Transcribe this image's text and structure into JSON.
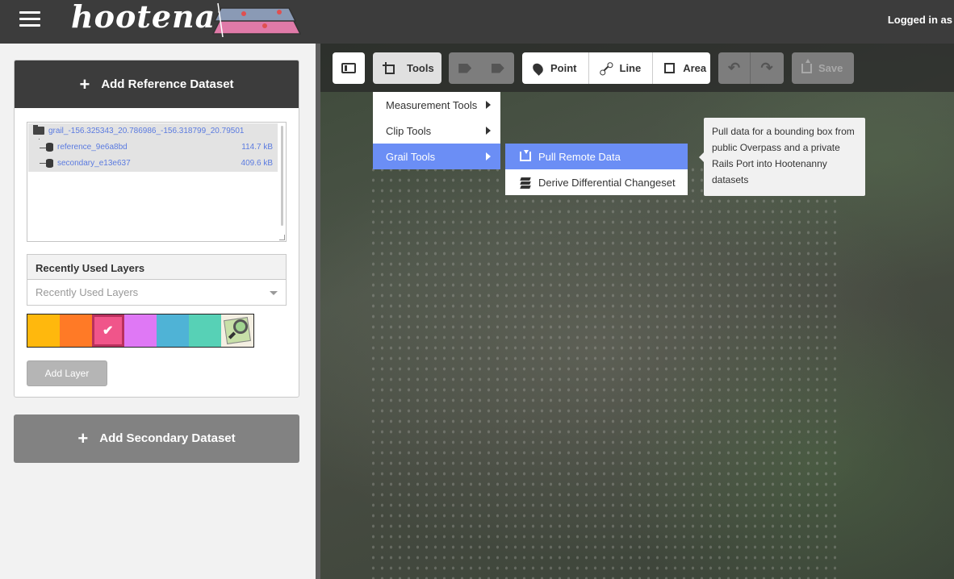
{
  "app": {
    "name": "hootenanny",
    "login_text": "Logged in as"
  },
  "sidebar": {
    "reference_panel": {
      "add_label": "Add Reference Dataset",
      "tree": {
        "folder": "grail_-156.325343_20.786986_-156.318799_20.79501",
        "items": [
          {
            "name": "reference_9e6a8bd",
            "size": "114.7 kB"
          },
          {
            "name": "secondary_e13e637",
            "size": "409.6 kB"
          }
        ]
      },
      "recent_layers": {
        "title": "Recently Used Layers",
        "placeholder": "Recently Used Layers"
      },
      "palette": [
        "#ffb80d",
        "#ff7a26",
        "#f0558a",
        "#df78f5",
        "#4fb3d6",
        "#57d1b6"
      ],
      "selected_swatch": 2,
      "add_layer_label": "Add Layer"
    },
    "secondary_panel": {
      "add_label": "Add Secondary Dataset"
    }
  },
  "toolbar": {
    "tools_label": "Tools",
    "point_label": "Point",
    "line_label": "Line",
    "area_label": "Area",
    "save_label": "Save"
  },
  "tools_menu": {
    "items": [
      {
        "label": "Measurement Tools"
      },
      {
        "label": "Clip Tools"
      },
      {
        "label": "Grail Tools"
      }
    ],
    "active_index": 2
  },
  "grail_menu": {
    "items": [
      {
        "label": "Pull Remote Data"
      },
      {
        "label": "Derive Differential Changeset"
      }
    ]
  },
  "tooltip": {
    "text": "Pull data for a bounding box from public Overpass and a private Rails Port into Hootenanny datasets"
  },
  "colors": {
    "accent": "#6b8ef5",
    "header_bg": "#3c3c3c",
    "link_blue": "#5b7be0"
  }
}
